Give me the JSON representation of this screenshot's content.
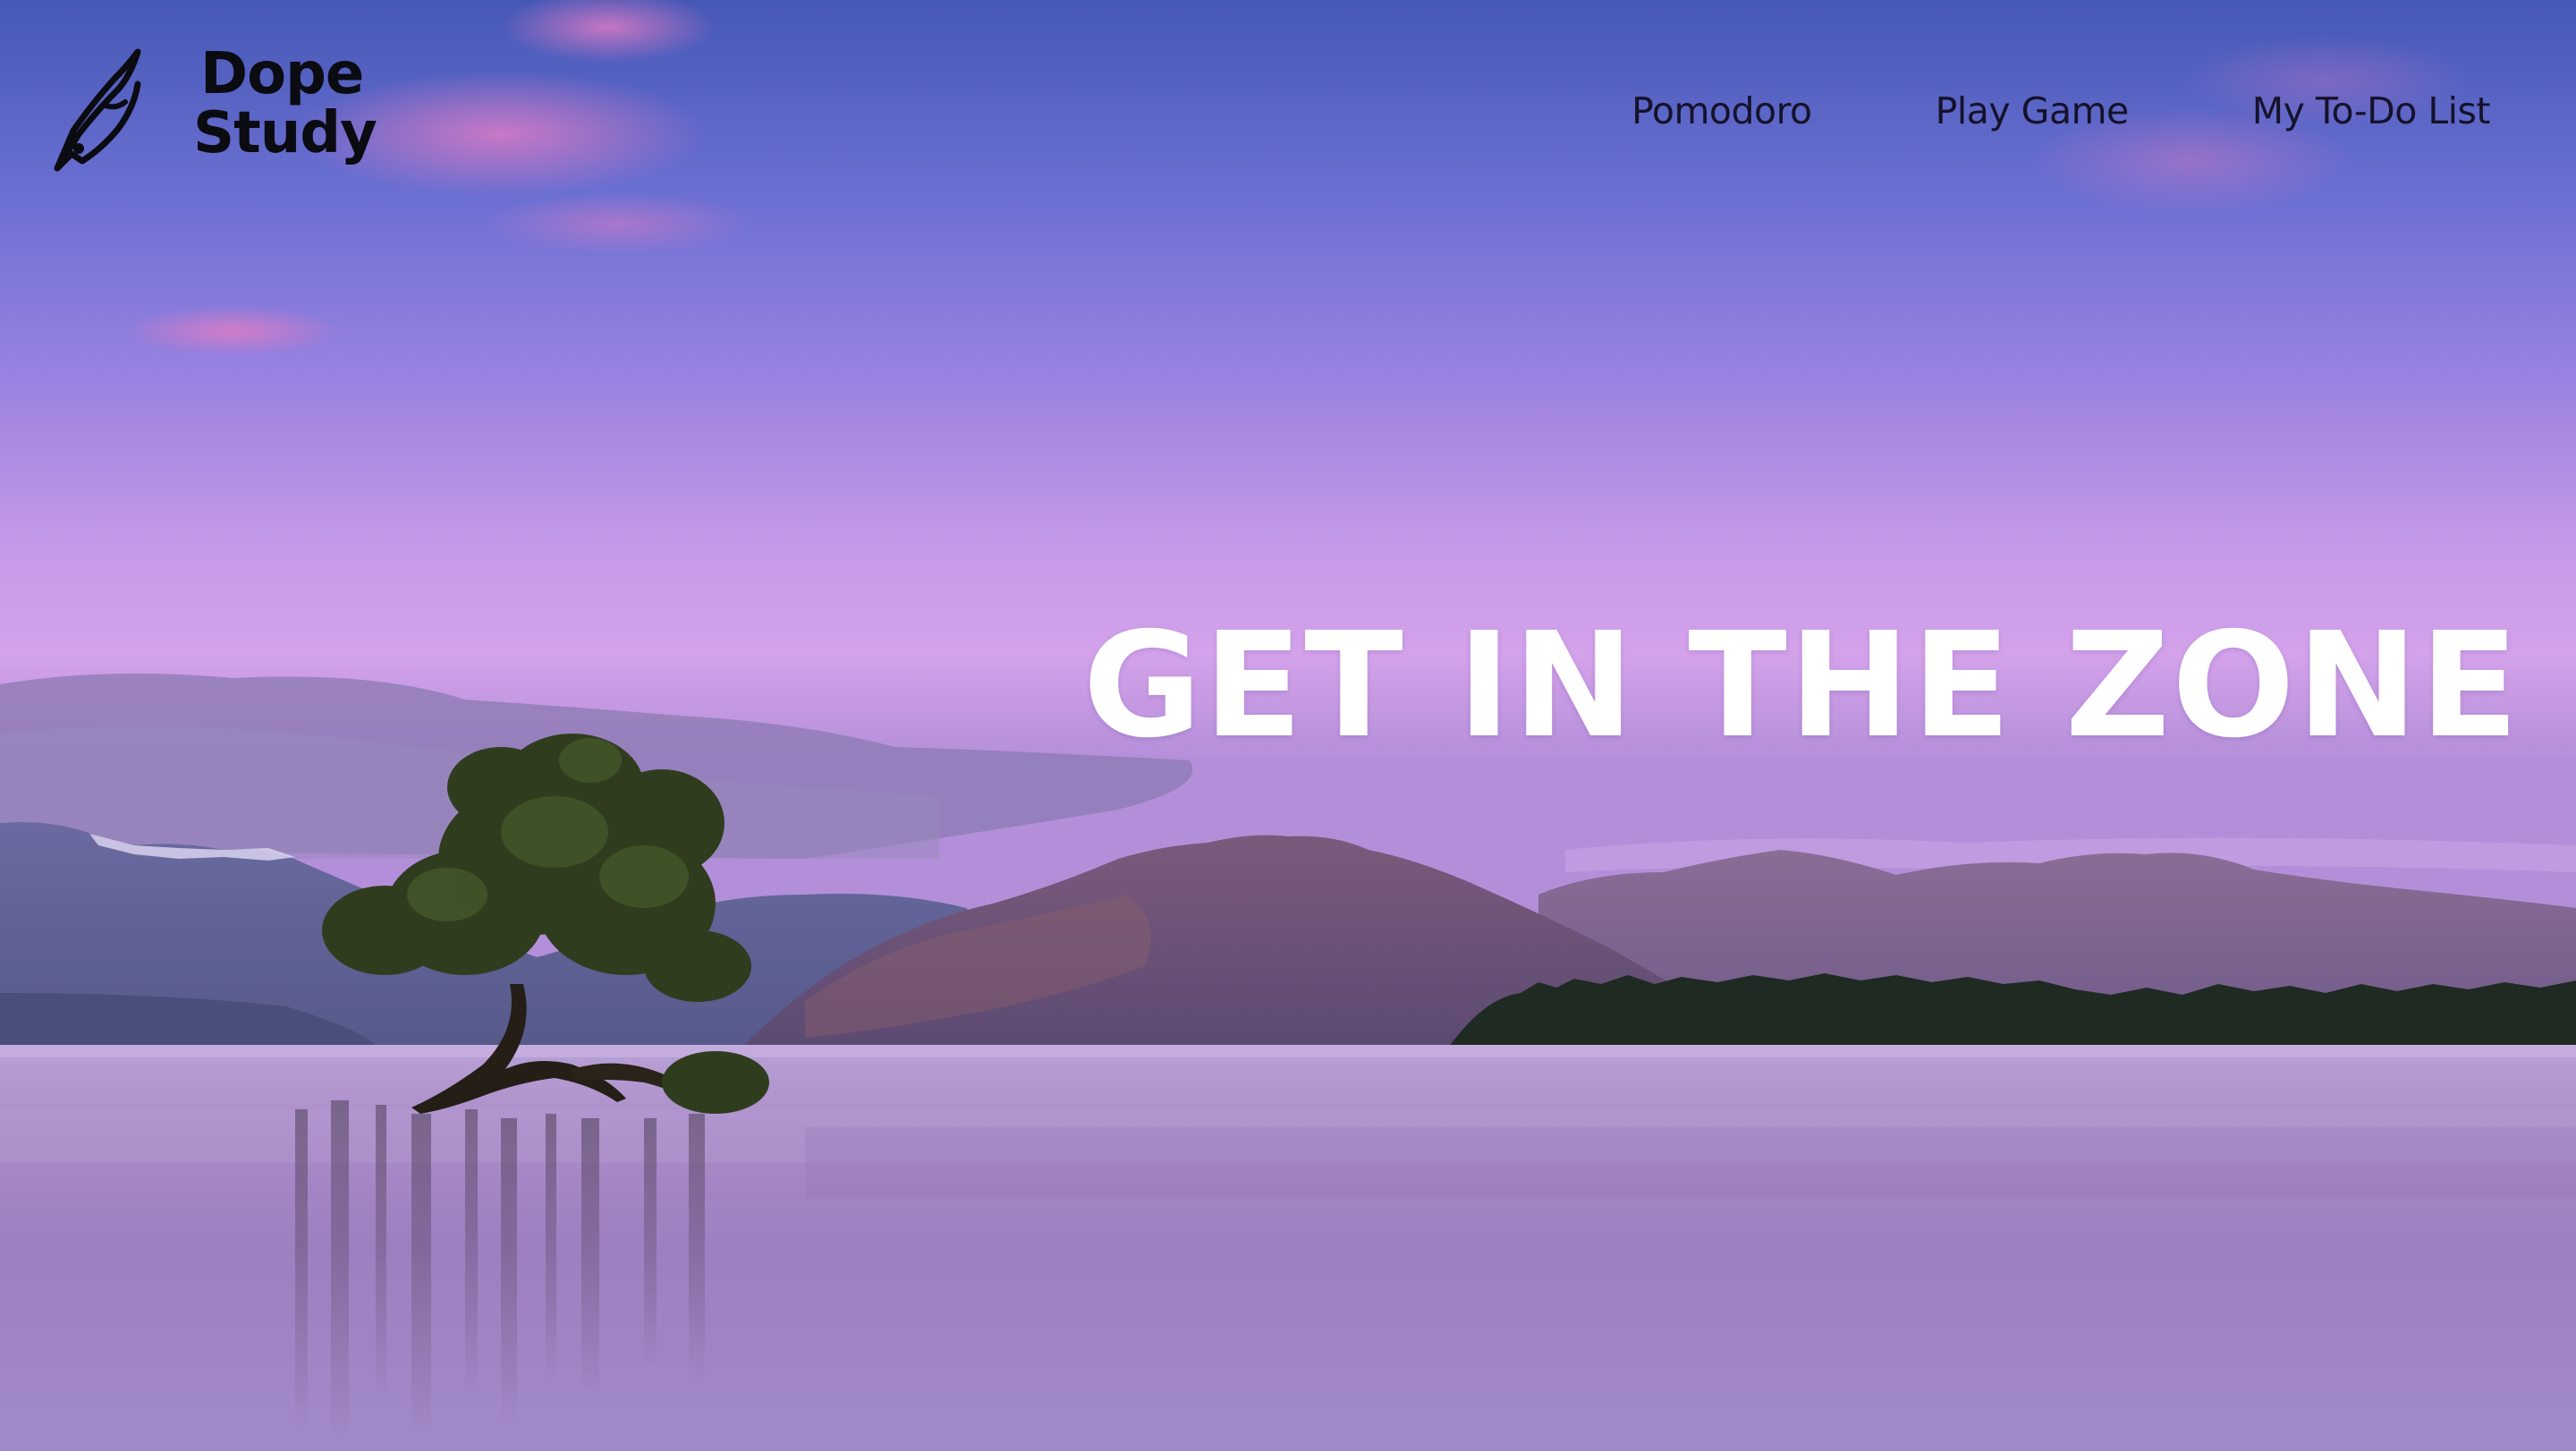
{
  "brand": {
    "logo_line1": "Dope",
    "logo_line2": "Study",
    "logo_icon": "fountain-pen-icon"
  },
  "nav": {
    "items": [
      {
        "label": "Pomodoro"
      },
      {
        "label": "Play Game"
      },
      {
        "label": "My To-Do List"
      }
    ]
  },
  "hero": {
    "title": "GET IN THE ZONE"
  },
  "theme": {
    "sky_top": "#4a5ab8",
    "sky_mid": "#9a80df",
    "sky_horizon": "#d6a4ea",
    "water": "#a98cc8",
    "text_dark": "#0b0b12",
    "hero_text": "#ffffff"
  }
}
